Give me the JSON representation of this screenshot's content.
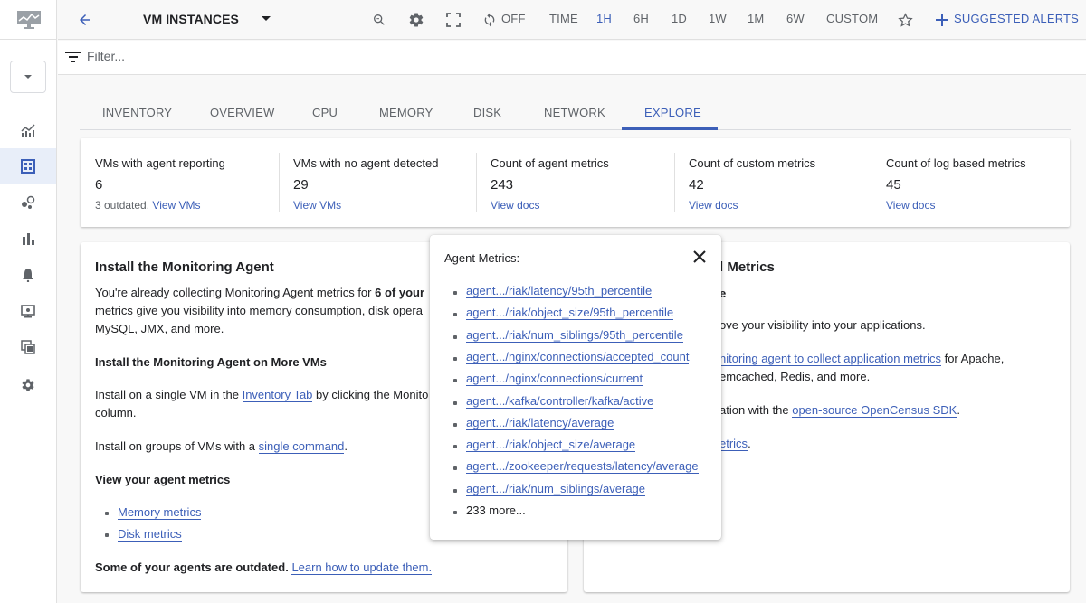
{
  "topbar": {
    "dashboard_title": "VM INSTANCES",
    "auto_refresh": "OFF",
    "time_label": "TIME",
    "time_ranges": [
      "1H",
      "6H",
      "1D",
      "1W",
      "1M",
      "6W",
      "CUSTOM"
    ],
    "active_time_range": "1H",
    "suggested_alerts": "SUGGESTED ALERTS"
  },
  "filter": {
    "placeholder": "Filter..."
  },
  "tabs": [
    {
      "label": "INVENTORY"
    },
    {
      "label": "OVERVIEW"
    },
    {
      "label": "CPU"
    },
    {
      "label": "MEMORY"
    },
    {
      "label": "DISK"
    },
    {
      "label": "NETWORK"
    },
    {
      "label": "EXPLORE",
      "active": true
    }
  ],
  "stats": [
    {
      "label": "VMs with agent reporting",
      "value": "6",
      "prefix": "3 outdated.",
      "link": "View VMs"
    },
    {
      "label": "VMs with no agent detected",
      "value": "29",
      "prefix": "",
      "link": "View VMs"
    },
    {
      "label": "Count of agent metrics",
      "value": "243",
      "prefix": "",
      "link": "View docs"
    },
    {
      "label": "Count of custom metrics",
      "value": "42",
      "prefix": "",
      "link": "View docs"
    },
    {
      "label": "Count of log based metrics",
      "value": "45",
      "prefix": "",
      "link": "View docs"
    }
  ],
  "left_card": {
    "title": "Install the Monitoring Agent",
    "intro_line1_a": "You're already collecting Monitoring Agent metrics for ",
    "intro_line1_b": "6 of your",
    "intro_line2": "metrics give you visibility into memory consumption, disk opera",
    "intro_line3": "MySQL, JMX, and more.",
    "install_more_heading": "Install the Monitoring Agent on More VMs",
    "single_vm_a": "Install on a single VM in the ",
    "single_vm_link": "Inventory Tab",
    "single_vm_b": " by clicking the Monito",
    "single_vm_line2": "column.",
    "groups_a": "Install on groups of VMs with a ",
    "groups_link": "single command",
    "groups_b": ".",
    "view_metrics_heading": "View your agent metrics",
    "metric_links": [
      "Memory metrics",
      "Disk metrics"
    ],
    "outdated_text": "Some of your agents are outdated. ",
    "outdated_link": "Learn how to update them."
  },
  "right_card": {
    "title_visible": "l Metrics",
    "subtitle_visible": "e",
    "line1": "ove your visibility into your applications.",
    "line2_link": "nitoring agent to collect application metrics",
    "line2_b": " for Apache,",
    "line3": "emcached, Redis, and more.",
    "line4_a": "ation with the ",
    "line4_link": "open-source OpenCensus SDK",
    "line4_b": ".",
    "line5_link": "etrics",
    "line5_b": "."
  },
  "popup": {
    "title": "Agent Metrics:",
    "items": [
      "agent.../riak/latency/95th_percentile",
      "agent.../riak/object_size/95th_percentile",
      "agent.../riak/num_siblings/95th_percentile",
      "agent.../nginx/connections/accepted_count",
      "agent.../nginx/connections/current",
      "agent.../kafka/controller/kafka/active",
      "agent.../riak/latency/average",
      "agent.../riak/object_size/average",
      "agent.../zookeeper/requests/latency/average",
      "agent.../riak/num_siblings/average"
    ],
    "more": "233 more..."
  },
  "colors": {
    "accent": "#3c5fb8",
    "text": "#202124",
    "muted": "#5f6368"
  }
}
